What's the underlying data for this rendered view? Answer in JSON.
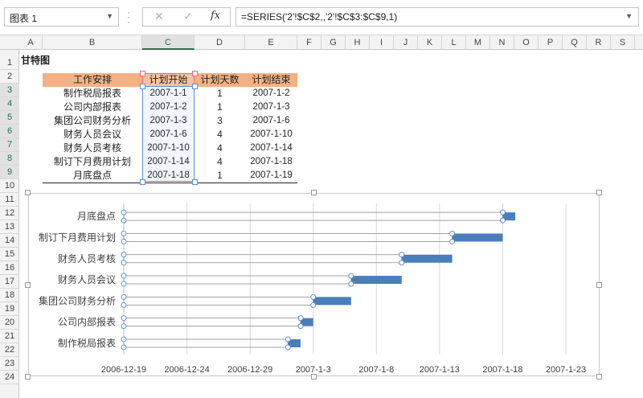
{
  "name_box": {
    "value": "图表 1"
  },
  "formula_bar": {
    "cancel_icon": "✕",
    "enter_icon": "✓",
    "fx_label": "fx",
    "formula": "=SERIES('2'!$C$2,,'2'!$C$3:$C$9,1)"
  },
  "columns": [
    "A",
    "B",
    "C",
    "D",
    "E",
    "F",
    "G",
    "H",
    "I",
    "J",
    "K",
    "L",
    "M",
    "N",
    "O",
    "P",
    "Q",
    "R",
    "S"
  ],
  "rows": [
    "1",
    "2",
    "3",
    "4",
    "5",
    "6",
    "7",
    "8",
    "9",
    "10",
    "11",
    "12",
    "13",
    "14",
    "15",
    "16",
    "17",
    "18",
    "19",
    "20",
    "21",
    "22",
    "23",
    "24"
  ],
  "sheet": {
    "title": "甘特图",
    "headers": [
      "工作安排",
      "计划开始",
      "计划天数",
      "计划结束"
    ],
    "rows": [
      {
        "task": "制作税局报表",
        "start": "2007-1-1",
        "days": "1",
        "end": "2007-1-2"
      },
      {
        "task": "公司内部报表",
        "start": "2007-1-2",
        "days": "1",
        "end": "2007-1-3"
      },
      {
        "task": "集团公司财务分析",
        "start": "2007-1-3",
        "days": "3",
        "end": "2007-1-6"
      },
      {
        "task": "财务人员会议",
        "start": "2007-1-6",
        "days": "4",
        "end": "2007-1-10"
      },
      {
        "task": "财务人员考核",
        "start": "2007-1-10",
        "days": "4",
        "end": "2007-1-14"
      },
      {
        "task": "制订下月费用计划",
        "start": "2007-1-14",
        "days": "4",
        "end": "2007-1-18"
      },
      {
        "task": "月底盘点",
        "start": "2007-1-18",
        "days": "1",
        "end": "2007-1-19"
      }
    ]
  },
  "chart_data": {
    "type": "bar",
    "orientation": "horizontal-stacked",
    "categories": [
      "制作税局报表",
      "公司内部报表",
      "集团公司财务分析",
      "财务人员会议",
      "财务人员考核",
      "制订下月费用计划",
      "月底盘点"
    ],
    "series": [
      {
        "values": [
          "2007-1-1",
          "2007-1-2",
          "2007-1-3",
          "2007-1-6",
          "2007-1-10",
          "2007-1-14",
          "2007-1-18"
        ],
        "fill": "none",
        "selected": true
      },
      {
        "values": [
          1,
          1,
          3,
          4,
          4,
          4,
          1
        ],
        "color": "#4a7ebb"
      }
    ],
    "x_ticks": [
      "2006-12-19",
      "2006-12-24",
      "2006-12-29",
      "2007-1-3",
      "2007-1-8",
      "2007-1-13",
      "2007-1-18",
      "2007-1-23"
    ],
    "xlim": [
      "2006-12-19",
      "2007-1-23"
    ],
    "grid": "vertical",
    "legend": "none"
  }
}
